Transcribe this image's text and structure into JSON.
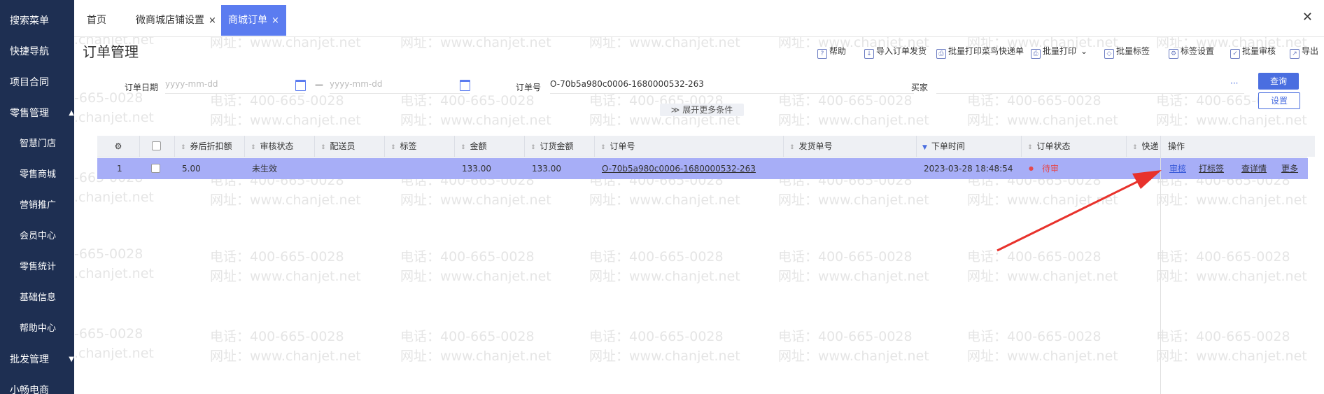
{
  "sidebar": {
    "items": [
      {
        "label": "搜索菜单",
        "kind": "top"
      },
      {
        "label": "快捷导航",
        "kind": "top"
      },
      {
        "label": "项目合同",
        "kind": "top"
      },
      {
        "label": "零售管理",
        "kind": "top",
        "caret": "▲"
      },
      {
        "label": "智慧门店",
        "kind": "sub"
      },
      {
        "label": "零售商城",
        "kind": "sub"
      },
      {
        "label": "营销推广",
        "kind": "sub"
      },
      {
        "label": "会员中心",
        "kind": "sub"
      },
      {
        "label": "零售统计",
        "kind": "sub"
      },
      {
        "label": "基础信息",
        "kind": "sub"
      },
      {
        "label": "帮助中心",
        "kind": "sub"
      },
      {
        "label": "批发管理",
        "kind": "top",
        "caret": "▼"
      },
      {
        "label": "小畅电商",
        "kind": "top"
      }
    ]
  },
  "tabs": [
    {
      "label": "首页",
      "closable": false
    },
    {
      "label": "微商城店铺设置",
      "closable": true
    },
    {
      "label": "商城订单",
      "closable": true,
      "active": true
    }
  ],
  "tab_close_glyph": "×",
  "window_close_glyph": "✕",
  "page_title": "订单管理",
  "toolbar": [
    {
      "label": "帮助",
      "icon": "help-icon"
    },
    {
      "label": "导入订单发货",
      "icon": "import-icon"
    },
    {
      "label": "批量打印菜鸟快递单",
      "icon": "print-icon"
    },
    {
      "label": "批量打印",
      "icon": "print-icon",
      "dropdown": "⌄"
    },
    {
      "label": "批量标签",
      "icon": "tag-icon"
    },
    {
      "label": "标签设置",
      "icon": "tag-settings-icon"
    },
    {
      "label": "批量审核",
      "icon": "audit-icon"
    },
    {
      "label": "导出",
      "icon": "export-icon"
    }
  ],
  "filters": {
    "order_date_label": "订单日期",
    "date_from_placeholder": "yyyy-mm-dd",
    "date_sep": "—",
    "date_to_placeholder": "yyyy-mm-dd",
    "order_no_label": "订单号",
    "order_no_value": "O-70b5a980c0006-1680000532-263",
    "buyer_label": "买家",
    "more_glyph": "···",
    "expand_label": "展开更多条件",
    "expand_glyph": "≫",
    "query_button": "查询",
    "settings_button": "设置"
  },
  "table": {
    "columns": [
      "券后折扣额",
      "审核状态",
      "配送员",
      "标签",
      "金额",
      "订货金额",
      "订单号",
      "发货单号",
      "下单时间",
      "订单状态",
      "快递"
    ],
    "op_header": "操作",
    "rows": [
      {
        "index": "1",
        "discount": "5.00",
        "audit_status": "未生效",
        "courier": "",
        "tag": "",
        "amount": "133.00",
        "order_amount": "133.00",
        "order_no": "O-70b5a980c0006-1680000532-263",
        "ship_no": "",
        "order_time": "2023-03-28 18:48:54",
        "order_status": "待审",
        "express": ""
      }
    ],
    "row_actions": [
      "审核",
      "打标签",
      "查详情",
      "更多"
    ]
  },
  "watermark": {
    "phone": "电话：400-665-0028",
    "site": "网址：www.chanjet.net",
    "phone_partial": "-665-0028",
    "site_partial": ".chanjet.net"
  },
  "colors": {
    "sidebar_bg": "#1e2f52",
    "accent": "#4a6ee0",
    "row_highlight": "#a7aef7",
    "status_red": "#e5484d",
    "arrow": "#e8322c"
  }
}
